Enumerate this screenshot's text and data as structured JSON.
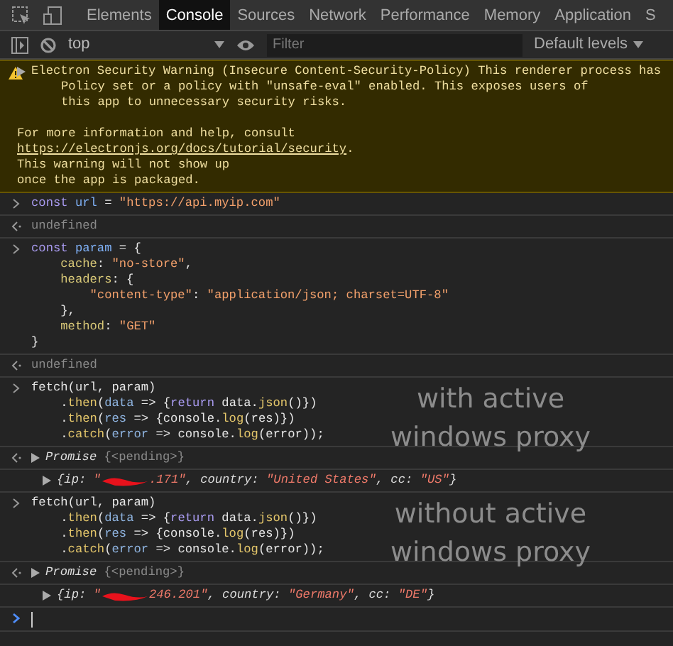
{
  "tabs": [
    {
      "label": "Elements",
      "selected": false
    },
    {
      "label": "Console",
      "selected": true
    },
    {
      "label": "Sources",
      "selected": false
    },
    {
      "label": "Network",
      "selected": false
    },
    {
      "label": "Performance",
      "selected": false
    },
    {
      "label": "Memory",
      "selected": false
    },
    {
      "label": "Application",
      "selected": false
    },
    {
      "label": "S",
      "selected": false
    }
  ],
  "toolbar": {
    "context": "top",
    "filter_placeholder": "Filter",
    "levels": "Default levels"
  },
  "console": [
    {
      "kind": "warning",
      "paragraphs": [
        [
          [
            {
              "kind": "text",
              "text": "Electron Security Warning (Insecure Content-Security-Policy) This renderer process has"
            }
          ],
          [
            {
              "kind": "text",
              "text": "      Policy set or a policy with \"unsafe-eval\" enabled. This exposes users of"
            }
          ],
          [
            {
              "kind": "text",
              "text": "      this app to unnecessary security risks."
            }
          ]
        ],
        [
          [
            {
              "kind": "text",
              "text": "For more information and help, consult"
            }
          ],
          [
            {
              "kind": "link",
              "text": "https://electronjs.org/docs/tutorial/security"
            },
            {
              "kind": "text",
              "text": "."
            }
          ],
          [
            {
              "kind": "text",
              "text": "This warning will not show up"
            }
          ],
          [
            {
              "kind": "text",
              "text": "once the app is packaged."
            }
          ]
        ]
      ]
    },
    {
      "kind": "input",
      "lines": [
        [
          {
            "kind": "keyword",
            "text": "const "
          },
          {
            "kind": "variable",
            "text": "url"
          },
          {
            "kind": "plain",
            "text": " = "
          },
          {
            "kind": "string",
            "text": "\"https://api.myip.com\""
          }
        ]
      ]
    },
    {
      "kind": "result",
      "lines": [
        [
          {
            "kind": "dim",
            "text": "undefined"
          }
        ]
      ]
    },
    {
      "kind": "input",
      "lines": [
        [
          {
            "kind": "keyword",
            "text": "const "
          },
          {
            "kind": "variable",
            "text": "param"
          },
          {
            "kind": "plain",
            "text": " = {"
          }
        ],
        [
          {
            "kind": "property",
            "text": "    cache"
          },
          {
            "kind": "plain",
            "text": ": "
          },
          {
            "kind": "string",
            "text": "\"no-store\""
          },
          {
            "kind": "plain",
            "text": ","
          }
        ],
        [
          {
            "kind": "property",
            "text": "    headers"
          },
          {
            "kind": "plain",
            "text": ": {"
          }
        ],
        [
          {
            "kind": "string",
            "text": "        \"content-type\""
          },
          {
            "kind": "plain",
            "text": ": "
          },
          {
            "kind": "string",
            "text": "\"application/json; charset=UTF-8\""
          }
        ],
        [
          {
            "kind": "plain",
            "text": "    },"
          }
        ],
        [
          {
            "kind": "property",
            "text": "    method"
          },
          {
            "kind": "plain",
            "text": ": "
          },
          {
            "kind": "string",
            "text": "\"GET\""
          }
        ],
        [
          {
            "kind": "plain",
            "text": "}"
          }
        ]
      ]
    },
    {
      "kind": "result",
      "lines": [
        [
          {
            "kind": "dim",
            "text": "undefined"
          }
        ]
      ]
    },
    {
      "kind": "input",
      "overlay": [
        "with active",
        "windows proxy"
      ],
      "lines": [
        [
          {
            "kind": "plain",
            "text": "fetch(url, param)"
          }
        ],
        [
          {
            "kind": "plain",
            "text": "    ."
          },
          {
            "kind": "method",
            "text": "then"
          },
          {
            "kind": "plain",
            "text": "("
          },
          {
            "kind": "param",
            "text": "data"
          },
          {
            "kind": "plain",
            "text": " => {"
          },
          {
            "kind": "keyword",
            "text": "return"
          },
          {
            "kind": "plain",
            "text": " data."
          },
          {
            "kind": "method",
            "text": "json"
          },
          {
            "kind": "plain",
            "text": "()})"
          }
        ],
        [
          {
            "kind": "plain",
            "text": "    ."
          },
          {
            "kind": "method",
            "text": "then"
          },
          {
            "kind": "plain",
            "text": "("
          },
          {
            "kind": "param",
            "text": "res"
          },
          {
            "kind": "plain",
            "text": " => {console."
          },
          {
            "kind": "method",
            "text": "log"
          },
          {
            "kind": "plain",
            "text": "(res)})"
          }
        ],
        [
          {
            "kind": "plain",
            "text": "    ."
          },
          {
            "kind": "method",
            "text": "catch"
          },
          {
            "kind": "plain",
            "text": "("
          },
          {
            "kind": "param",
            "text": "error"
          },
          {
            "kind": "plain",
            "text": " => console."
          },
          {
            "kind": "method",
            "text": "log"
          },
          {
            "kind": "plain",
            "text": "(error));"
          }
        ]
      ]
    },
    {
      "kind": "result",
      "expandable": true,
      "lines": [
        [
          {
            "kind": "object",
            "text": "Promise "
          },
          {
            "kind": "dim",
            "text": "{<pending>}"
          }
        ]
      ]
    },
    {
      "kind": "log",
      "expandable": true,
      "lines": [
        [
          {
            "kind": "object",
            "text": "{ip: "
          },
          {
            "kind": "value",
            "text": "\""
          },
          {
            "kind": "redacted"
          },
          {
            "kind": "value",
            "text": ".171\""
          },
          {
            "kind": "object",
            "text": ", country: "
          },
          {
            "kind": "value",
            "text": "\"United States\""
          },
          {
            "kind": "object",
            "text": ", cc: "
          },
          {
            "kind": "value",
            "text": "\"US\""
          },
          {
            "kind": "object",
            "text": "}"
          }
        ]
      ]
    },
    {
      "kind": "input",
      "overlay": [
        "without active",
        "windows proxy"
      ],
      "lines": [
        [
          {
            "kind": "plain",
            "text": "fetch(url, param)"
          }
        ],
        [
          {
            "kind": "plain",
            "text": "    ."
          },
          {
            "kind": "method",
            "text": "then"
          },
          {
            "kind": "plain",
            "text": "("
          },
          {
            "kind": "param",
            "text": "data"
          },
          {
            "kind": "plain",
            "text": " => {"
          },
          {
            "kind": "keyword",
            "text": "return"
          },
          {
            "kind": "plain",
            "text": " data."
          },
          {
            "kind": "method",
            "text": "json"
          },
          {
            "kind": "plain",
            "text": "()})"
          }
        ],
        [
          {
            "kind": "plain",
            "text": "    ."
          },
          {
            "kind": "method",
            "text": "then"
          },
          {
            "kind": "plain",
            "text": "("
          },
          {
            "kind": "param",
            "text": "res"
          },
          {
            "kind": "plain",
            "text": " => {console."
          },
          {
            "kind": "method",
            "text": "log"
          },
          {
            "kind": "plain",
            "text": "(res)})"
          }
        ],
        [
          {
            "kind": "plain",
            "text": "    ."
          },
          {
            "kind": "method",
            "text": "catch"
          },
          {
            "kind": "plain",
            "text": "("
          },
          {
            "kind": "param",
            "text": "error"
          },
          {
            "kind": "plain",
            "text": " => console."
          },
          {
            "kind": "method",
            "text": "log"
          },
          {
            "kind": "plain",
            "text": "(error));"
          }
        ]
      ]
    },
    {
      "kind": "result",
      "expandable": true,
      "lines": [
        [
          {
            "kind": "object",
            "text": "Promise "
          },
          {
            "kind": "dim",
            "text": "{<pending>}"
          }
        ]
      ]
    },
    {
      "kind": "log",
      "expandable": true,
      "lines": [
        [
          {
            "kind": "object",
            "text": "{ip: "
          },
          {
            "kind": "value",
            "text": "\""
          },
          {
            "kind": "redacted"
          },
          {
            "kind": "value",
            "text": "246.201\""
          },
          {
            "kind": "object",
            "text": ", country: "
          },
          {
            "kind": "value",
            "text": "\"Germany\""
          },
          {
            "kind": "object",
            "text": ", cc: "
          },
          {
            "kind": "value",
            "text": "\"DE\""
          },
          {
            "kind": "object",
            "text": "}"
          }
        ]
      ]
    },
    {
      "kind": "prompt"
    }
  ]
}
